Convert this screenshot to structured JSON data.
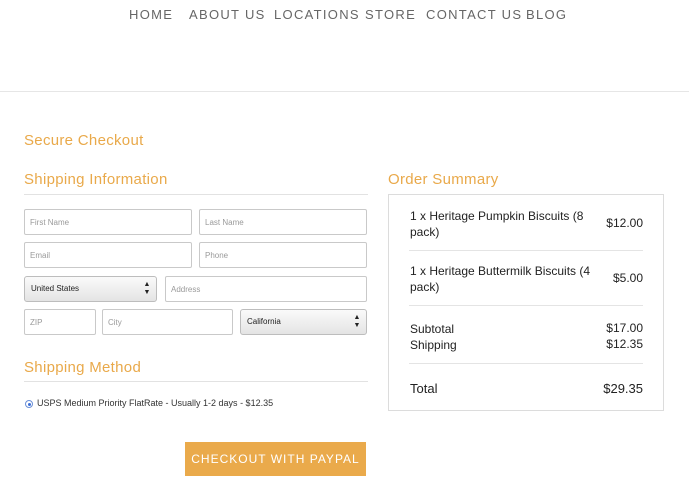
{
  "nav": {
    "items": [
      {
        "label": "HOME"
      },
      {
        "label": "ABOUT US"
      },
      {
        "label": "LOCATIONS"
      },
      {
        "label": "STORE"
      },
      {
        "label": "CONTACT US"
      },
      {
        "label": "BLOG"
      }
    ]
  },
  "checkout": {
    "title": "Secure Checkout",
    "shipping_info_title": "Shipping Information",
    "fields": {
      "first_name": {
        "placeholder": "First Name",
        "value": ""
      },
      "last_name": {
        "placeholder": "Last Name",
        "value": ""
      },
      "email": {
        "placeholder": "Email",
        "value": ""
      },
      "phone": {
        "placeholder": "Phone",
        "value": ""
      },
      "country": {
        "selected": "United States"
      },
      "address": {
        "placeholder": "Address",
        "value": ""
      },
      "zip": {
        "placeholder": "ZIP",
        "value": ""
      },
      "city": {
        "placeholder": "City",
        "value": ""
      },
      "state": {
        "selected": "California"
      }
    },
    "shipping_method_title": "Shipping Method",
    "shipping_option": {
      "label": "USPS Medium Priority FlatRate - Usually 1-2 days - $12.35",
      "selected": true
    },
    "paypal_button": "CHECKOUT WITH PAYPAL"
  },
  "summary": {
    "title": "Order Summary",
    "items": [
      {
        "description": "1 x Heritage Pumpkin Biscuits (8 pack)",
        "price": "$12.00"
      },
      {
        "description": "1 x Heritage Buttermilk Biscuits (4 pack)",
        "price": "$5.00"
      }
    ],
    "subtotal_label": "Subtotal",
    "subtotal_value": "$17.00",
    "shipping_label": "Shipping",
    "shipping_value": "$12.35",
    "total_label": "Total",
    "total_value": "$29.35"
  },
  "colors": {
    "accent": "#e9a94a",
    "button": "#eaaa4b",
    "nav_text": "#666666"
  }
}
